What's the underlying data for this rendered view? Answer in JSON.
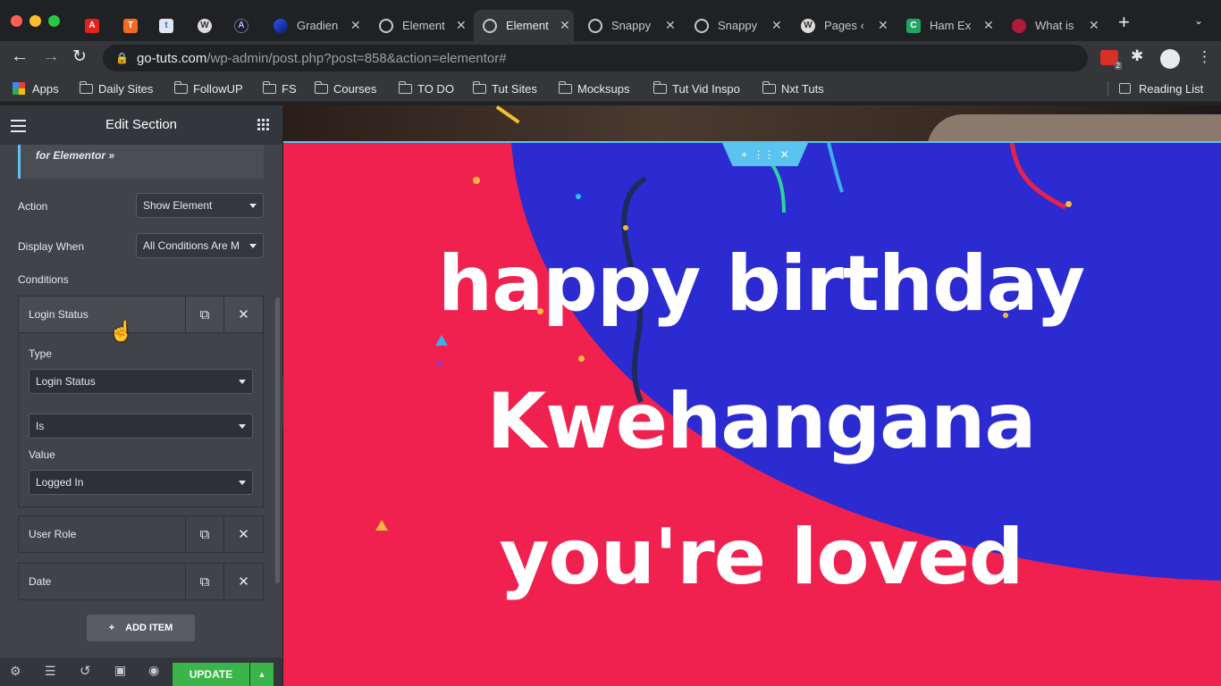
{
  "browser": {
    "tabs": [
      {
        "title": "",
        "icon": "acrobat-icon"
      },
      {
        "title": "",
        "icon": "t-orange-icon"
      },
      {
        "title": "",
        "icon": "t-blue-icon"
      },
      {
        "title": "",
        "icon": "wordpress-icon"
      },
      {
        "title": "",
        "icon": "astra-icon"
      },
      {
        "title": "Gradien",
        "icon": "gradient-icon"
      },
      {
        "title": "Element",
        "icon": "globe-icon"
      },
      {
        "title": "Element",
        "icon": "globe-icon"
      },
      {
        "title": "Snappy",
        "icon": "globe-icon"
      },
      {
        "title": "Snappy",
        "icon": "globe-icon"
      },
      {
        "title": "Pages ‹",
        "icon": "wordpress-icon"
      },
      {
        "title": "Ham Ex",
        "icon": "ham-icon"
      },
      {
        "title": "What is",
        "icon": "wpbeginner-icon"
      }
    ],
    "url_host": "go-tuts.com",
    "url_path": "/wp-admin/post.php?post=858&action=elementor#",
    "extension_badge": "2",
    "bookmarks": [
      "Apps",
      "Daily Sites",
      "FollowUP",
      "FS",
      "Courses",
      "TO DO",
      "Tut Sites",
      "Mocksups",
      "Tut Vid Inspo",
      "Nxt Tuts"
    ],
    "reading_list": "Reading List"
  },
  "panel": {
    "title": "Edit Section",
    "promo_text": "for Elementor »",
    "action_label": "Action",
    "action_value": "Show Element",
    "display_when_label": "Display When",
    "display_when_value": "All Conditions Are M",
    "conditions_label": "Conditions",
    "condition_open": {
      "title": "Login Status",
      "type_label": "Type",
      "type_value": "Login Status",
      "operator_value": "Is",
      "value_label": "Value",
      "value_value": "Logged In"
    },
    "condition_items": [
      "User Role",
      "Date"
    ],
    "add_item": "ADD ITEM",
    "update": "UPDATE"
  },
  "canvas": {
    "line1": "happy birthday",
    "line2": "Kwehangana",
    "line3": "you're loved",
    "colors": {
      "red": "#f0214f",
      "blue": "#2b2bd1",
      "accent": "#5bc3f0"
    }
  }
}
